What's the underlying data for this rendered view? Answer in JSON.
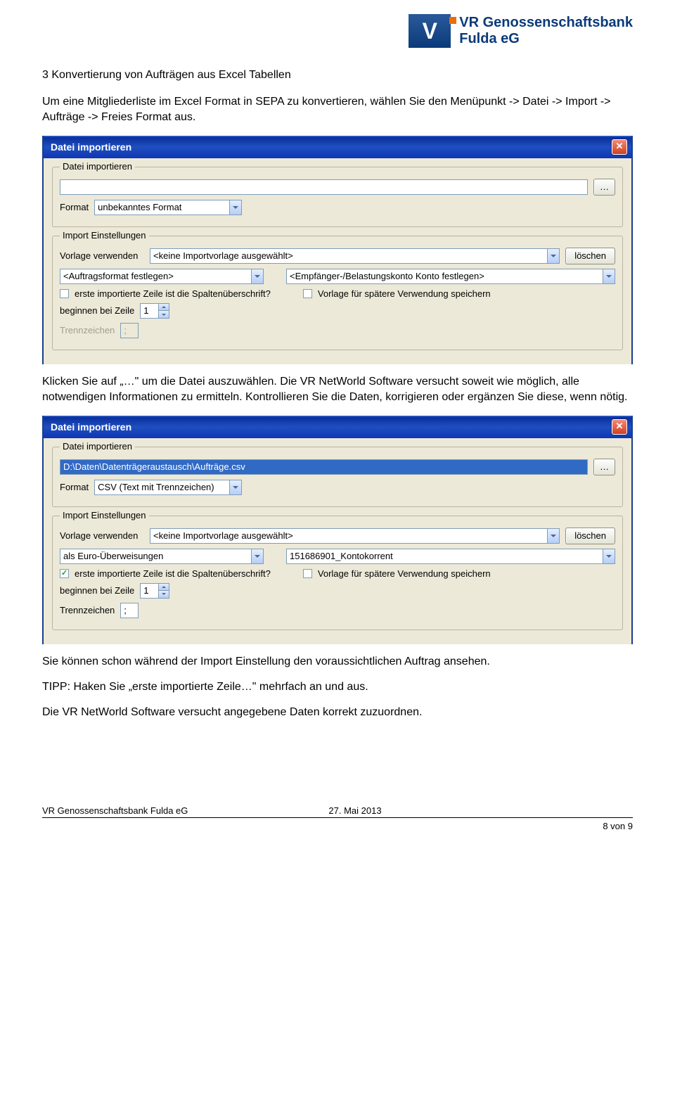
{
  "logo": {
    "brand_line1": "VR Genossenschaftsbank",
    "brand_line2": "Fulda eG"
  },
  "heading": "3 Konvertierung von Aufträgen aus Excel Tabellen",
  "p1": "Um eine Mitgliederliste im Excel Format in SEPA zu konvertieren, wählen Sie den Menüpunkt -> Datei -> Import -> Aufträge -> Freies Format aus.",
  "p2": "Klicken Sie auf „…\" um die Datei auszuwählen. Die VR NetWorld Software versucht soweit wie möglich, alle notwendigen Informationen zu ermitteln. Kontrollieren Sie die Daten, korrigieren oder ergänzen Sie diese, wenn nötig.",
  "p3": "Sie können schon während der Import Einstellung den voraussichtlichen Auftrag ansehen.",
  "p4": "TIPP: Haken Sie „erste importierte Zeile…\" mehrfach an und aus.",
  "p5": "Die VR NetWorld Software versucht angegebene Daten korrekt zuzuordnen.",
  "dlg1": {
    "title": "Datei importieren",
    "fs_import": "Datei importieren",
    "file_value": "",
    "browse": "…",
    "format_label": "Format",
    "format_value": "unbekanntes Format",
    "fs_settings": "Import Einstellungen",
    "template_label": "Vorlage verwenden",
    "template_value": "<keine Importvorlage ausgewählt>",
    "delete_btn": "löschen",
    "order_format_value": "<Auftragsformat festlegen>",
    "account_value": "<Empfänger-/Belastungskonto Konto festlegen>",
    "cb_first_row": "erste importierte Zeile ist die Spaltenüberschrift?",
    "cb_save_template": "Vorlage für spätere Verwendung speichern",
    "begin_label": "beginnen bei Zeile",
    "begin_value": "1",
    "sep_label": "Trennzeichen",
    "sep_value": ";"
  },
  "dlg2": {
    "title": "Datei importieren",
    "fs_import": "Datei importieren",
    "file_value": "D:\\Daten\\Datenträgeraustausch\\Aufträge.csv",
    "browse": "…",
    "format_label": "Format",
    "format_value": "CSV (Text mit Trennzeichen)",
    "fs_settings": "Import Einstellungen",
    "template_label": "Vorlage verwenden",
    "template_value": "<keine Importvorlage ausgewählt>",
    "delete_btn": "löschen",
    "order_format_value": "als Euro-Überweisungen",
    "account_value": "151686901_Kontokorrent",
    "cb_first_row": "erste importierte Zeile ist die Spaltenüberschrift?",
    "cb_save_template": "Vorlage für spätere Verwendung speichern",
    "begin_label": "beginnen bei Zeile",
    "begin_value": "1",
    "sep_label": "Trennzeichen",
    "sep_value": ";"
  },
  "footer_left": "VR Genossenschaftsbank Fulda eG",
  "footer_right": "27. Mai 2013",
  "page_num": "8 von 9"
}
